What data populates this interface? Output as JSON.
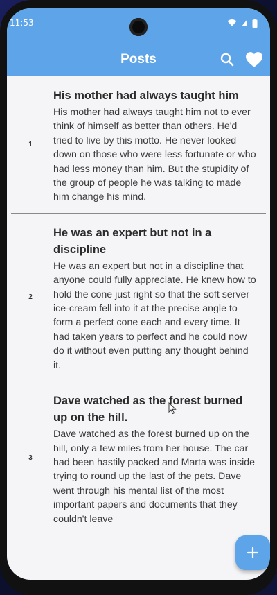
{
  "status_bar": {
    "time": "11:53",
    "icons": [
      "wifi-icon",
      "signal-icon",
      "battery-icon"
    ]
  },
  "app_bar": {
    "title": "Posts",
    "actions": [
      "search-icon",
      "heart-icon"
    ],
    "color": "#5ea4e9"
  },
  "posts": [
    {
      "index": "1",
      "title": "His mother had always taught him",
      "body": "His mother had always taught him not to ever think of himself as better than others. He'd tried to live by this motto. He never looked down on those who were less fortunate or who had less money than him. But the stupidity of the group of people he was talking to made him change his mind."
    },
    {
      "index": "2",
      "title": "He was an expert but not in a discipline",
      "body": "He was an expert but not in a discipline that anyone could fully appreciate. He knew how to hold the cone just right so that the soft server ice-cream fell into it at the precise angle to form a perfect cone each and every time. It had taken years to perfect and he could now do it without even putting any thought behind it."
    },
    {
      "index": "3",
      "title": "Dave watched as the forest burned up on the hill.",
      "body": "Dave watched as the forest burned up on the hill, only a few miles from her house. The car had been hastily packed and Marta was inside trying to round up the last of the pets. Dave went through his mental list of the most important papers and documents that they couldn't leave"
    }
  ],
  "fab": {
    "icon": "plus-icon"
  }
}
